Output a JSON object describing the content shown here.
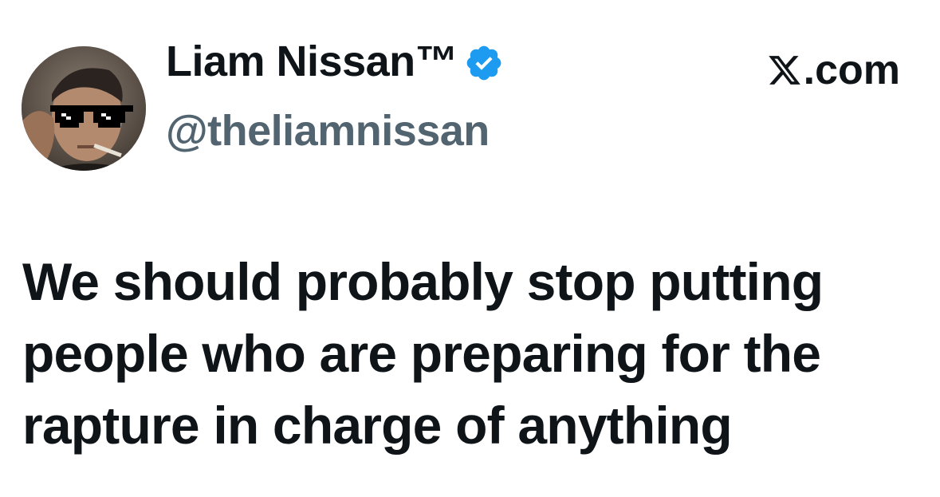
{
  "author": {
    "display_name": "Liam Nissan™",
    "handle": "@theliamnissan",
    "verified": true,
    "verified_badge_icon": "verified-badge-icon",
    "verified_color": "#1d9bf0",
    "avatar_icon": "avatar-photo"
  },
  "brand": {
    "icon": "x-logo-icon",
    "label": ".com"
  },
  "tweet": {
    "text": "We should probably stop putting people who are preparing for the rapture in charge of anything"
  },
  "colors": {
    "text_primary": "#0f1419",
    "text_secondary": "#536471",
    "background": "#ffffff"
  }
}
